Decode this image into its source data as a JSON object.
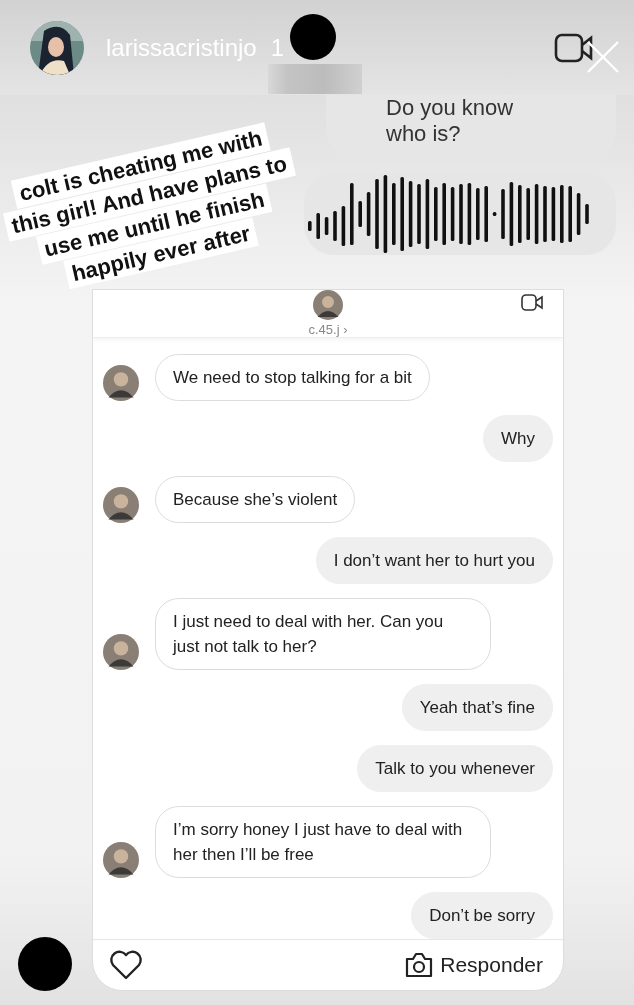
{
  "story": {
    "username": "larissacristinjo",
    "time": "1"
  },
  "background_chat": [
    {
      "kind": "text",
      "text": "Do you know who is?"
    },
    {
      "kind": "voice"
    }
  ],
  "caption": "colt is cheating me with this girl! And have plans to use me until he finish happily ever after",
  "dm": {
    "username": "c.45.j",
    "chevron": "›",
    "messages": [
      {
        "kind": "received",
        "text": "We need to stop talking for a bit"
      },
      {
        "kind": "sent",
        "text": "Why"
      },
      {
        "kind": "received",
        "text": "Because she’s violent"
      },
      {
        "kind": "sent",
        "text": "I don’t want her to hurt you"
      },
      {
        "kind": "received",
        "text": "I just need to deal with her. Can you just not talk to her?"
      },
      {
        "kind": "sent",
        "text": "Yeah that’s fine"
      },
      {
        "kind": "sent",
        "text": "Talk to you whenever"
      },
      {
        "kind": "received",
        "text": "I’m sorry honey I just have to deal with her then I’ll be free"
      },
      {
        "kind": "sent",
        "text": "Don’t be sorry"
      }
    ]
  },
  "footer": {
    "reply": "Responder"
  }
}
